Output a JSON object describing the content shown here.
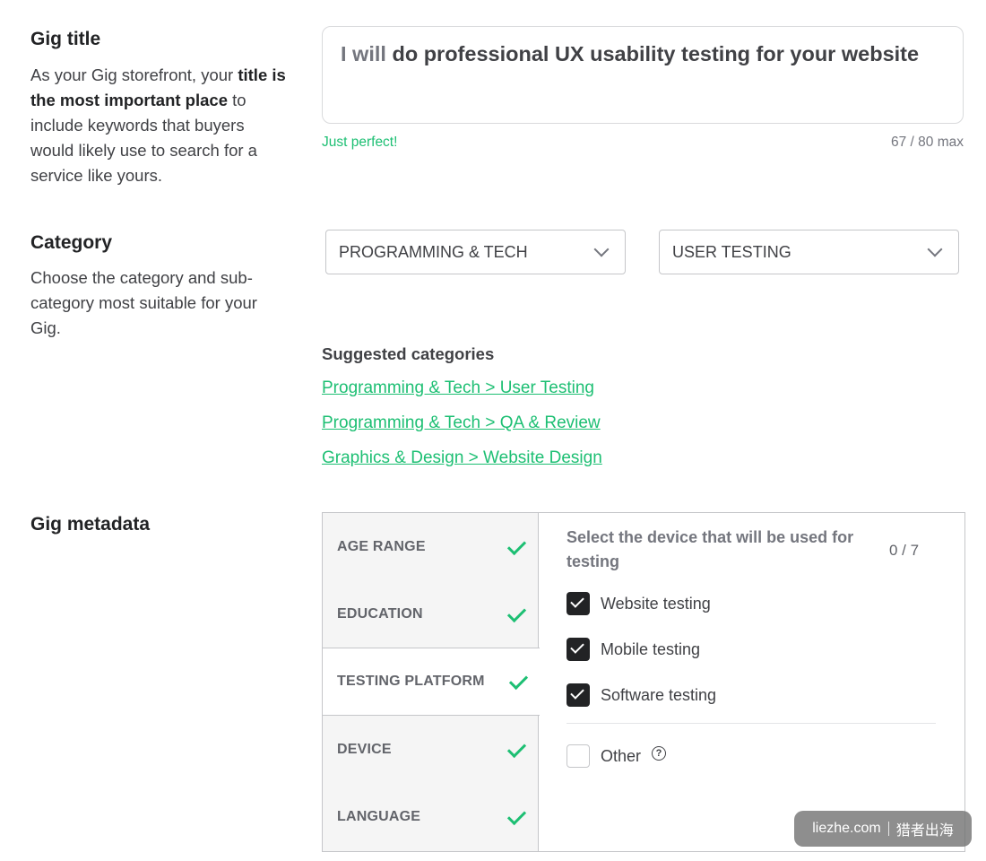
{
  "gig_title": {
    "heading": "Gig title",
    "desc_1": "As your Gig storefront, your ",
    "desc_bold": "title is the most important place",
    "desc_2": " to include keywords that buyers would likely use to search for a service like yours.",
    "prefix": "I will",
    "value": " do professional UX usability testing for your website",
    "hint": "Just perfect!",
    "counter": "67 / 80 max"
  },
  "category": {
    "heading": "Category",
    "desc": "Choose the category and sub-category most suitable for your Gig.",
    "select_main": "PROGRAMMING & TECH",
    "select_sub": "USER TESTING",
    "suggested_title": "Suggested categories",
    "suggestions": [
      "Programming & Tech > User Testing",
      "Programming & Tech > QA & Review",
      "Graphics & Design > Website Design"
    ]
  },
  "metadata": {
    "heading": "Gig metadata",
    "tabs": [
      {
        "label": "AGE RANGE",
        "done": true
      },
      {
        "label": "EDUCATION",
        "done": true
      },
      {
        "label": "TESTING PLATFORM",
        "done": true,
        "active": true
      },
      {
        "label": "DEVICE",
        "done": true
      },
      {
        "label": "LANGUAGE",
        "done": true
      }
    ],
    "question": "Select the device that will be used for testing",
    "count": "0 / 7",
    "options": [
      {
        "label": "Website testing",
        "checked": true
      },
      {
        "label": "Mobile testing",
        "checked": true
      },
      {
        "label": "Software testing",
        "checked": true
      },
      {
        "label": "Other",
        "checked": false
      }
    ],
    "help_glyph": "?"
  },
  "watermark": {
    "site": "liezhe.com",
    "brand": "猎者出海"
  },
  "colors": {
    "accent_green": "#1dbf73",
    "dark": "#222325",
    "border": "#c5c6c9",
    "tab_bg": "#f5f5f5"
  }
}
